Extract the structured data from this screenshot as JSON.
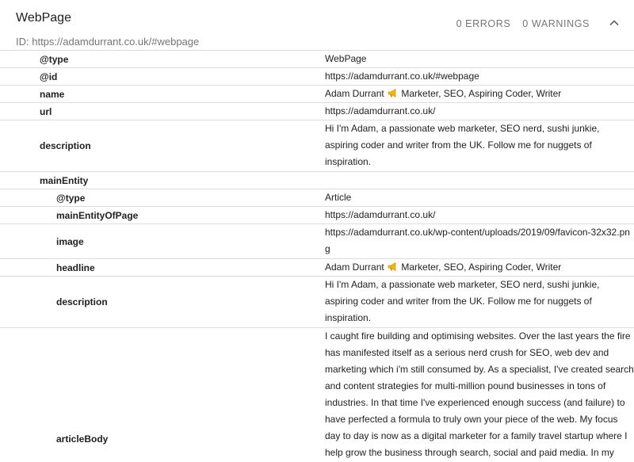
{
  "header": {
    "title": "WebPage",
    "id_text": "ID: https://adamdurrant.co.uk/#webpage",
    "errors": "0 ERRORS",
    "warnings": "0 WARNINGS",
    "collapse_icon": "chevron-up-icon"
  },
  "rows": {
    "type": {
      "key": "@type",
      "value": "WebPage"
    },
    "id": {
      "key": "@id",
      "value": "https://adamdurrant.co.uk/#webpage"
    },
    "name": {
      "key": "name",
      "value_pre": "Adam Durrant",
      "value_post": "Marketer, SEO, Aspiring Coder, Writer"
    },
    "url": {
      "key": "url",
      "value": "https://adamdurrant.co.uk/"
    },
    "description": {
      "key": "description",
      "value": "Hi I'm Adam, a passionate web marketer, SEO nerd, sushi junkie, aspiring coder and writer from the UK. Follow me for nuggets of inspiration."
    },
    "mainEntity": {
      "key": "mainEntity",
      "value": ""
    },
    "me_type": {
      "key": "@type",
      "value": "Article"
    },
    "me_page": {
      "key": "mainEntityOfPage",
      "value": "https://adamdurrant.co.uk/"
    },
    "me_image": {
      "key": "image",
      "value": "https://adamdurrant.co.uk/wp-content/uploads/2019/09/favicon-32x32.png"
    },
    "me_headline": {
      "key": "headline",
      "value_pre": "Adam Durrant",
      "value_post": "Marketer, SEO, Aspiring Coder, Writer"
    },
    "me_description": {
      "key": "description",
      "value": "Hi I'm Adam, a passionate web marketer, SEO nerd, sushi junkie, aspiring coder and writer from the UK. Follow me for nuggets of inspiration."
    },
    "me_body": {
      "key": "articleBody",
      "value": "I caught fire building and optimising websites. Over the last years the fire has manifested itself as a serious nerd crush for SEO, web dev and marketing which i'm still consumed by. As a specialist, I've created search and content strategies for multi-million pound businesses in tons of industries. In that time I've experienced enough success (and failure) to have perfected a formula to truly own your piece of the web. My focus day to day is now as a digital marketer for a family travel startup where I help grow the business through search, social and paid media. In my"
    }
  },
  "emoji_icon": "megaphone-emoji-icon"
}
